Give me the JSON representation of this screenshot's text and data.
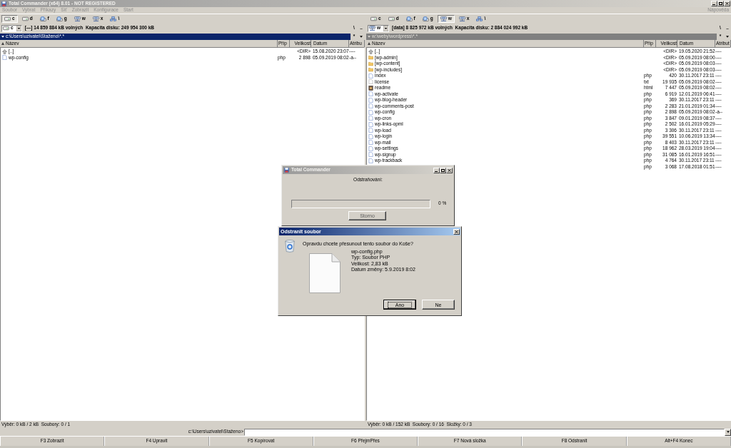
{
  "window": {
    "title": "Total Commander (x64) 8.01 - NOT REGISTERED",
    "active": false
  },
  "menu": {
    "items": [
      {
        "label": "Soubor",
        "disabled": true
      },
      {
        "label": "Vybrat",
        "disabled": true
      },
      {
        "label": "Příkazy",
        "disabled": true
      },
      {
        "label": "Síť",
        "disabled": true
      },
      {
        "label": "Zobrazit",
        "disabled": true
      },
      {
        "label": "Konfigurace",
        "disabled": true
      },
      {
        "label": "Start",
        "disabled": true
      }
    ],
    "help": {
      "label": "Nápověda",
      "disabled": true
    }
  },
  "panels": [
    {
      "active": true,
      "drives": [
        {
          "letter": "c",
          "kind": "hdd",
          "selected": true
        },
        {
          "letter": "d",
          "kind": "hdd",
          "selected": false
        },
        {
          "letter": "f",
          "kind": "disc",
          "selected": false
        },
        {
          "letter": "g",
          "kind": "disc",
          "selected": false
        },
        {
          "letter": "w",
          "kind": "network",
          "selected": false
        },
        {
          "letter": "x",
          "kind": "network",
          "selected": false
        },
        {
          "letter": "\\",
          "kind": "root",
          "selected": false
        }
      ],
      "drive_combo": {
        "letter": "c",
        "kind": "hdd"
      },
      "disk_info": "[—] 14 859 884 kB volných  Kapacita disku: 249 954 300 kB",
      "root_button": "\\",
      "parent_button": "..",
      "path": "c:\\Users\\uzivatel\\Staženo\\*.*",
      "filter_button": "*",
      "columns": [
        {
          "label": "Název",
          "sorted": true
        },
        {
          "label": "Příp",
          "sorted": false
        },
        {
          "label": "Velikost",
          "sorted": false
        },
        {
          "label": "Datum",
          "sorted": false
        },
        {
          "label": "Atribu",
          "sorted": false
        }
      ],
      "rows": [
        {
          "kind": "up",
          "name": "[..]",
          "size": "<DIR>",
          "date": "15.08.2020 23:07",
          "attr": "----"
        },
        {
          "kind": "file",
          "name": "wp-config",
          "ext": "php",
          "size": "2 898",
          "date": "05.09.2019 08:02",
          "attr": "-a--"
        }
      ],
      "status": "Výběr: 0 kB / 2 kB  Soubory: 0 / 1"
    },
    {
      "active": false,
      "drives": [
        {
          "letter": "c",
          "kind": "hdd",
          "selected": false
        },
        {
          "letter": "d",
          "kind": "hdd",
          "selected": false
        },
        {
          "letter": "f",
          "kind": "disc",
          "selected": false
        },
        {
          "letter": "g",
          "kind": "disc",
          "selected": false
        },
        {
          "letter": "w",
          "kind": "network",
          "selected": true
        },
        {
          "letter": "x",
          "kind": "network",
          "selected": false
        },
        {
          "letter": "\\",
          "kind": "root",
          "selected": false
        }
      ],
      "drive_combo": {
        "letter": "w",
        "kind": "network"
      },
      "disk_info": "[data] 8 825 972 kB volných  Kapacita disku: 2 884 024 992 kB",
      "root_button": "\\",
      "parent_button": "..",
      "path": "w:\\weby\\wordpress\\*.*",
      "filter_button": "*",
      "columns": [
        {
          "label": "Název",
          "sorted": true
        },
        {
          "label": "Příp",
          "sorted": false
        },
        {
          "label": "Velikost",
          "sorted": false
        },
        {
          "label": "Datum",
          "sorted": false
        },
        {
          "label": "Atribut",
          "sorted": false
        }
      ],
      "rows": [
        {
          "kind": "up",
          "name": "[..]",
          "size": "<DIR>",
          "date": "19.05.2020 21:52",
          "attr": "----"
        },
        {
          "kind": "folder",
          "name": "[wp-admin]",
          "size": "<DIR>",
          "date": "05.09.2019 08:00",
          "attr": "----"
        },
        {
          "kind": "folder",
          "name": "[wp-content]",
          "size": "<DIR>",
          "date": "05.09.2019 08:03",
          "attr": "----"
        },
        {
          "kind": "folder",
          "name": "[wp-includes]",
          "size": "<DIR>",
          "date": "05.09.2019 08:03",
          "attr": "----"
        },
        {
          "kind": "file",
          "name": "index",
          "ext": "php",
          "size": "420",
          "date": "30.11.2017 23:11",
          "attr": "----"
        },
        {
          "kind": "text",
          "name": "license",
          "ext": "txt",
          "size": "19 935",
          "date": "05.09.2019 08:02",
          "attr": "----"
        },
        {
          "kind": "web",
          "name": "readme",
          "ext": "html",
          "size": "7 447",
          "date": "05.09.2019 08:02",
          "attr": "----"
        },
        {
          "kind": "file",
          "name": "wp-activate",
          "ext": "php",
          "size": "6 919",
          "date": "12.01.2019 06:41",
          "attr": "----"
        },
        {
          "kind": "file",
          "name": "wp-blog-header",
          "ext": "php",
          "size": "369",
          "date": "30.11.2017 23:11",
          "attr": "----"
        },
        {
          "kind": "file",
          "name": "wp-comments-post",
          "ext": "php",
          "size": "2 283",
          "date": "21.01.2019 01:34",
          "attr": "----"
        },
        {
          "kind": "file",
          "name": "wp-config",
          "ext": "php",
          "size": "2 898",
          "date": "05.09.2019 08:02",
          "attr": "-a--"
        },
        {
          "kind": "file",
          "name": "wp-cron",
          "ext": "php",
          "size": "3 847",
          "date": "09.01.2019 08:37",
          "attr": "----"
        },
        {
          "kind": "file",
          "name": "wp-links-opml",
          "ext": "php",
          "size": "2 502",
          "date": "16.01.2019 05:29",
          "attr": "----"
        },
        {
          "kind": "file",
          "name": "wp-load",
          "ext": "php",
          "size": "3 306",
          "date": "30.11.2017 23:11",
          "attr": "----"
        },
        {
          "kind": "file",
          "name": "wp-login",
          "ext": "php",
          "size": "39 551",
          "date": "10.06.2019 13:34",
          "attr": "----"
        },
        {
          "kind": "file",
          "name": "wp-mail",
          "ext": "php",
          "size": "8 403",
          "date": "30.11.2017 23:11",
          "attr": "----"
        },
        {
          "kind": "file",
          "name": "wp-settings",
          "ext": "php",
          "size": "18 962",
          "date": "28.03.2019 19:04",
          "attr": "----"
        },
        {
          "kind": "file",
          "name": "wp-signup",
          "ext": "php",
          "size": "31 085",
          "date": "16.01.2019 16:51",
          "attr": "----"
        },
        {
          "kind": "file",
          "name": "wp-trackback",
          "ext": "php",
          "size": "4 764",
          "date": "30.11.2017 23:11",
          "attr": "----"
        },
        {
          "ext": "php",
          "size": "3 068",
          "date": "17.08.2018 01:51",
          "attr": "----"
        }
      ],
      "status": "Výběr: 0 kB / 152 kB  Soubory: 0 / 16  Složky: 0 / 3"
    }
  ],
  "command_line": {
    "path": "c:\\Users\\uzivatel\\Staženo>"
  },
  "function_keys": [
    "F3 Zobrazit",
    "F4 Upravit",
    "F5 Kopírovat",
    "F6 PřejmPřes",
    "F7 Nová složka",
    "F8 Odstranit",
    "Alt+F4 Konec"
  ],
  "progress_dialog": {
    "title": "Total Commander",
    "active": false,
    "label": "Odstraňování:",
    "level": 0,
    "percent": "0 %",
    "button": {
      "label": "Storno",
      "disabled": true
    }
  },
  "delete_dialog": {
    "title": "Odstranit soubor",
    "active": true,
    "question": "Opravdu chcete přesunout tento soubor do Koše?",
    "details": [
      "wp-config.php",
      "Typ: Soubor PHP",
      "Velikost: 2,83 kB",
      "Datum změny: 5.9.2019 8:02"
    ],
    "buttons": [
      {
        "label": "Ano",
        "default": true
      },
      {
        "label": "Ne",
        "default": false
      }
    ]
  }
}
